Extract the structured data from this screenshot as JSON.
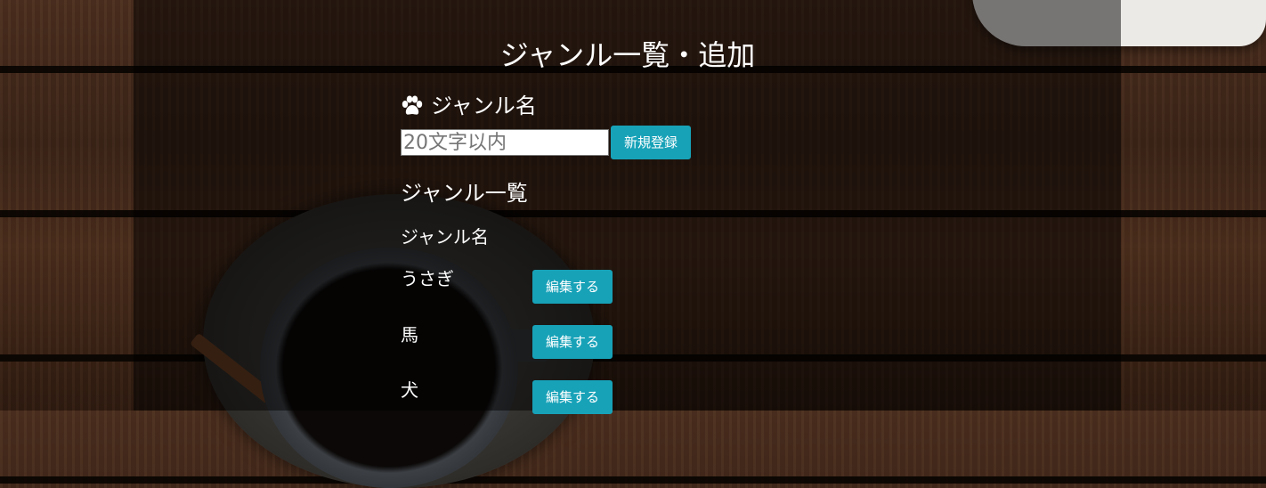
{
  "page": {
    "title": "ジャンル一覧・追加"
  },
  "form": {
    "label": "ジャンル名",
    "label_icon": "paw-icon",
    "input_value": "",
    "input_placeholder": "20文字以内",
    "submit_label": "新規登録"
  },
  "list": {
    "heading": "ジャンル一覧",
    "column_header": "ジャンル名",
    "rows": [
      {
        "name": "うさぎ",
        "action": "編集する"
      },
      {
        "name": "馬",
        "action": "編集する"
      },
      {
        "name": "犬",
        "action": "編集する"
      }
    ]
  },
  "colors": {
    "button": "#17a2b8",
    "overlay": "rgba(0,0,0,0.5)",
    "text": "#ffffff"
  }
}
